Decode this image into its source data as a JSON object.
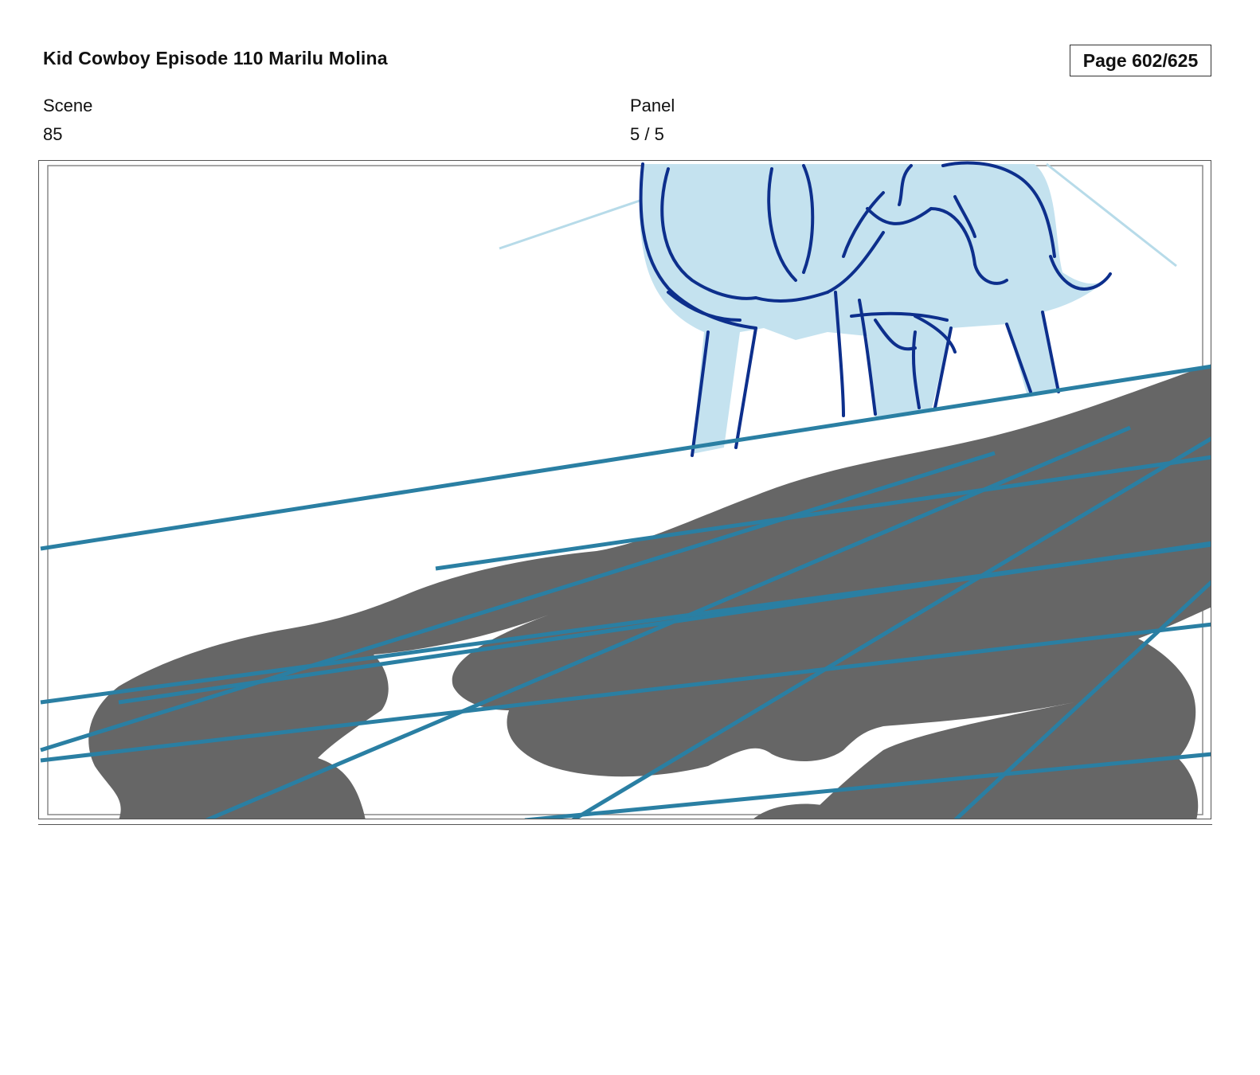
{
  "header": {
    "title": "Kid Cowboy Episode 110 Marilu Molina",
    "page": "Page 602/625"
  },
  "meta": {
    "scene_label": "Scene",
    "scene_value": "85",
    "panel_label": "Panel",
    "panel_value": "5 / 5"
  },
  "colors": {
    "shadow": "#666666",
    "horse_fill": "#c4e2ef",
    "horse_line": "#0d2f8c",
    "guide_line": "#2a7fa3",
    "light_line": "#b7dbe9"
  }
}
